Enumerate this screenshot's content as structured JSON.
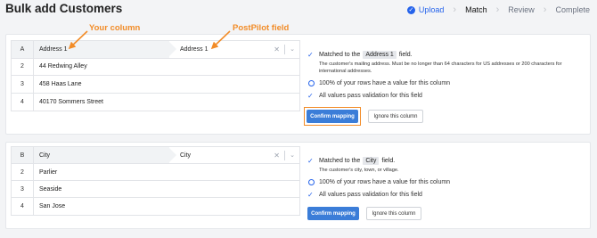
{
  "page": {
    "title": "Bulk add Customers"
  },
  "steps": [
    {
      "label": "Upload",
      "state": "done"
    },
    {
      "label": "Match",
      "state": "current"
    },
    {
      "label": "Review",
      "state": "pending"
    },
    {
      "label": "Complete",
      "state": "pending"
    }
  ],
  "annotations": {
    "your_column": "Your column",
    "postpilot_field": "PostPilot field"
  },
  "mappings": [
    {
      "col_letter": "A",
      "column_name": "Address 1",
      "selected_field": "Address 1",
      "rows": [
        {
          "n": "2",
          "value": "44 Redwing Alley"
        },
        {
          "n": "3",
          "value": "458 Haas Lane"
        },
        {
          "n": "4",
          "value": "40170 Sommers Street"
        }
      ],
      "matched_prefix": "Matched to the",
      "matched_field": "Address 1",
      "matched_suffix": "field.",
      "description": "The customer's mailing address. Must be no longer than 64 characters for US addresses or 200 characters for international addresses.",
      "stat_rows": "100% of your rows have a value for this column",
      "stat_valid": "All values pass validation for this field",
      "confirm_label": "Confirm mapping",
      "ignore_label": "Ignore this column"
    },
    {
      "col_letter": "B",
      "column_name": "City",
      "selected_field": "City",
      "rows": [
        {
          "n": "2",
          "value": "Parlier"
        },
        {
          "n": "3",
          "value": "Seaside"
        },
        {
          "n": "4",
          "value": "San Jose"
        }
      ],
      "matched_prefix": "Matched to the",
      "matched_field": "City",
      "matched_suffix": "field.",
      "description": "The customer's city, town, or village.",
      "stat_rows": "100% of your rows have a value for this column",
      "stat_valid": "All values pass validation for this field",
      "confirm_label": "Confirm mapping",
      "ignore_label": "Ignore this column"
    }
  ],
  "icons": {
    "clear": "close-icon",
    "dropdown": "chevron-down-icon",
    "check": "check-icon",
    "percent": "circle-icon",
    "step_done": "check-circle-icon"
  },
  "colors": {
    "accent": "#3b7dd8",
    "annotation": "#f28c28"
  }
}
